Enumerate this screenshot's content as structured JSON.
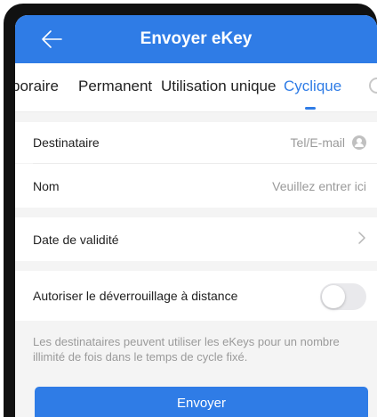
{
  "header": {
    "title": "Envoyer eKey",
    "back_icon": "back-arrow-icon"
  },
  "tabs": [
    {
      "label": "poraire",
      "active": false
    },
    {
      "label": "Permanent",
      "active": false
    },
    {
      "label": "Utilisation unique",
      "active": false
    },
    {
      "label": "Cyclique",
      "active": true
    }
  ],
  "form": {
    "recipient_label": "Destinataire",
    "recipient_placeholder": "Tel/E-mail",
    "name_label": "Nom",
    "name_placeholder": "Veuillez entrer ici",
    "validity_label": "Date de validité",
    "remote_unlock_label": "Autoriser le déverrouillage à distance",
    "remote_unlock_enabled": false
  },
  "note": "Les destinataires peuvent utiliser les eKeys pour un nombre illimité de fois dans le temps de cycle fixé.",
  "send_label": "Envoyer",
  "colors": {
    "accent": "#2f7ce6",
    "background": "#f4f4f4"
  }
}
